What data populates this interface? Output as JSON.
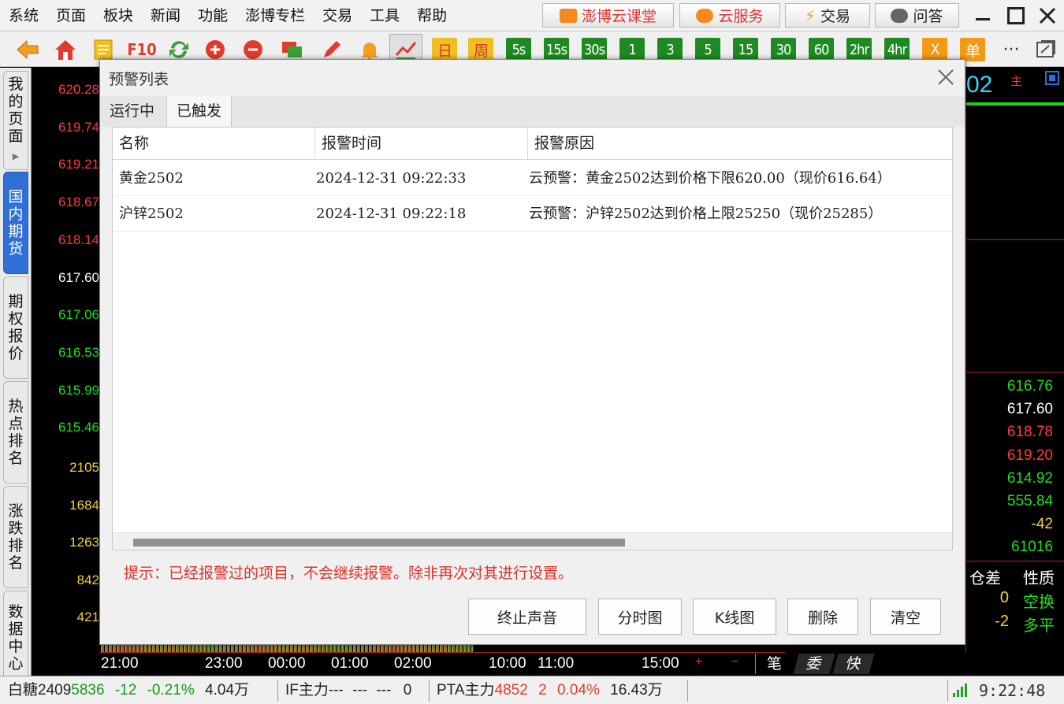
{
  "menu": [
    "系统",
    "页面",
    "板块",
    "新闻",
    "功能",
    "澎博专栏",
    "交易",
    "工具",
    "帮助"
  ],
  "top_buttons": {
    "class": "澎博云课堂",
    "cloud": "云服务",
    "trade": "交易",
    "qa": "问答"
  },
  "toolbar": {
    "f10": "F10",
    "periods": [
      "日",
      "周",
      "5s",
      "15s",
      "30s",
      "1",
      "3",
      "5",
      "15",
      "30",
      "60",
      "2hr",
      "4hr",
      "X",
      "单"
    ],
    "more": "···"
  },
  "sidebar": {
    "tabs": [
      "我的页面",
      "国内期货",
      "期权报价",
      "热点排名",
      "涨跌排名",
      "数据中心"
    ],
    "active": "国内期货"
  },
  "chart": {
    "price_labels": [
      "620.28",
      "619.74",
      "619.21",
      "618.67",
      "618.14",
      "617.60",
      "617.06",
      "616.53",
      "615.99",
      "615.46"
    ],
    "volume_labels": [
      "2105",
      "1684",
      "1263",
      "842",
      "421"
    ],
    "time_labels": [
      "21:00",
      "23:00",
      "00:00",
      "01:00",
      "02:00",
      "10:00",
      "11:00",
      "15:00"
    ],
    "contract_fragment": "02",
    "main_mark": "主",
    "right_values": [
      "616.76",
      "617.60",
      "618.78",
      "619.20",
      "614.92",
      "555.84",
      "-42",
      "61016"
    ],
    "tick_headers": {
      "oi_diff": "仓差",
      "nature": "性质"
    },
    "tick_rows": [
      {
        "oi_diff": "0",
        "nature": "空换"
      },
      {
        "oi_diff": "-2",
        "nature": "多平"
      }
    ],
    "bottom_tabs": [
      "笔",
      "委",
      "快"
    ],
    "plus": "+",
    "minus": "−"
  },
  "statusbar": {
    "s1": {
      "name": "白糖2409",
      "price": "5836",
      "change": "-12",
      "pct": "-0.21%",
      "vol": "4.04万"
    },
    "s2": {
      "name": "IF主力",
      "price": "---",
      "change": "---",
      "pct": "---",
      "vol": "0"
    },
    "s3": {
      "name": "PTA主力",
      "price": "4852",
      "change": "2",
      "pct": "0.04%",
      "vol": "16.43万"
    },
    "clock": "9:22:48"
  },
  "dialog": {
    "title": "预警列表",
    "tabs": [
      "运行中",
      "已触发"
    ],
    "active_tab": "已触发",
    "columns": [
      "名称",
      "报警时间",
      "报警原因"
    ],
    "rows": [
      {
        "name": "黄金2502",
        "time": "2024-12-31 09:22:33",
        "reason": "云预警：黄金2502达到价格下限620.00（现价616.64）"
      },
      {
        "name": "沪锌2502",
        "time": "2024-12-31 09:22:18",
        "reason": "云预警：沪锌2502达到价格上限25250（现价25285）"
      }
    ],
    "hint": "提示：已经报警过的项目，不会继续报警。除非再次对其进行设置。",
    "buttons": {
      "stop_sound": "终止声音",
      "intraday": "分时图",
      "kline": "K线图",
      "delete": "删除",
      "clear": "清空"
    }
  },
  "colors": {
    "up": "#ff3b3b",
    "down": "#22dd22",
    "neutral": "#ffffff",
    "volume": "#f5d23a",
    "cyan": "#2fd6ff",
    "active_tab": "#2f6fd6",
    "hint": "#d9342b"
  }
}
